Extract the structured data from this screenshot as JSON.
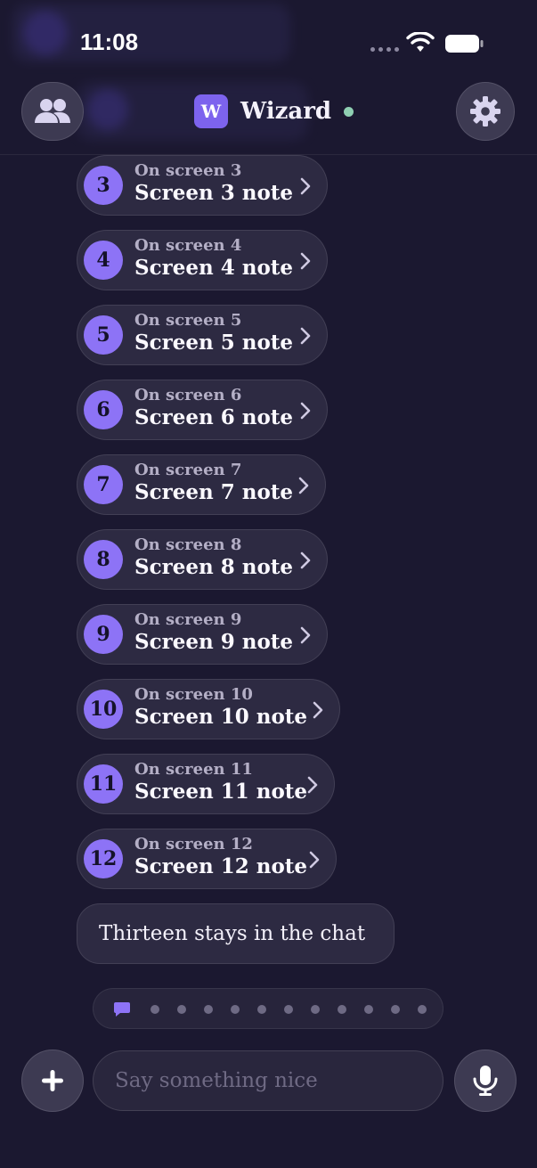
{
  "status_bar": {
    "time": "11:08"
  },
  "header": {
    "avatar_letter": "W",
    "title": "Wizard"
  },
  "notes": [
    {
      "number": "3",
      "subtitle": "On screen 3",
      "title": "Screen 3 note"
    },
    {
      "number": "4",
      "subtitle": "On screen 4",
      "title": "Screen 4 note"
    },
    {
      "number": "5",
      "subtitle": "On screen 5",
      "title": "Screen 5 note"
    },
    {
      "number": "6",
      "subtitle": "On screen 6",
      "title": "Screen 6 note"
    },
    {
      "number": "7",
      "subtitle": "On screen 7",
      "title": "Screen 7 note"
    },
    {
      "number": "8",
      "subtitle": "On screen 8",
      "title": "Screen 8 note"
    },
    {
      "number": "9",
      "subtitle": "On screen 9",
      "title": "Screen 9 note"
    },
    {
      "number": "10",
      "subtitle": "On screen 10",
      "title": "Screen 10 note"
    },
    {
      "number": "11",
      "subtitle": "On screen 11",
      "title": "Screen 11 note"
    },
    {
      "number": "12",
      "subtitle": "On screen 12",
      "title": "Screen 12 note"
    }
  ],
  "messages": [
    {
      "text": "Thirteen stays in the chat"
    }
  ],
  "pager": {
    "active_icon": "chat-bubble-icon",
    "dot_count": 11
  },
  "composer": {
    "placeholder": "Say something nice"
  },
  "icons": {
    "people": "people-icon",
    "settings": "gear-icon",
    "chevron": "chevron-right-icon",
    "plus": "plus-icon",
    "mic": "microphone-icon",
    "wifi": "wifi-icon",
    "battery": "battery-icon"
  },
  "colors": {
    "background": "#1b1830",
    "accent": "#7d63ee",
    "badge": "#8d73f6",
    "online": "#8fcfb2",
    "card": "#2d2a42"
  }
}
